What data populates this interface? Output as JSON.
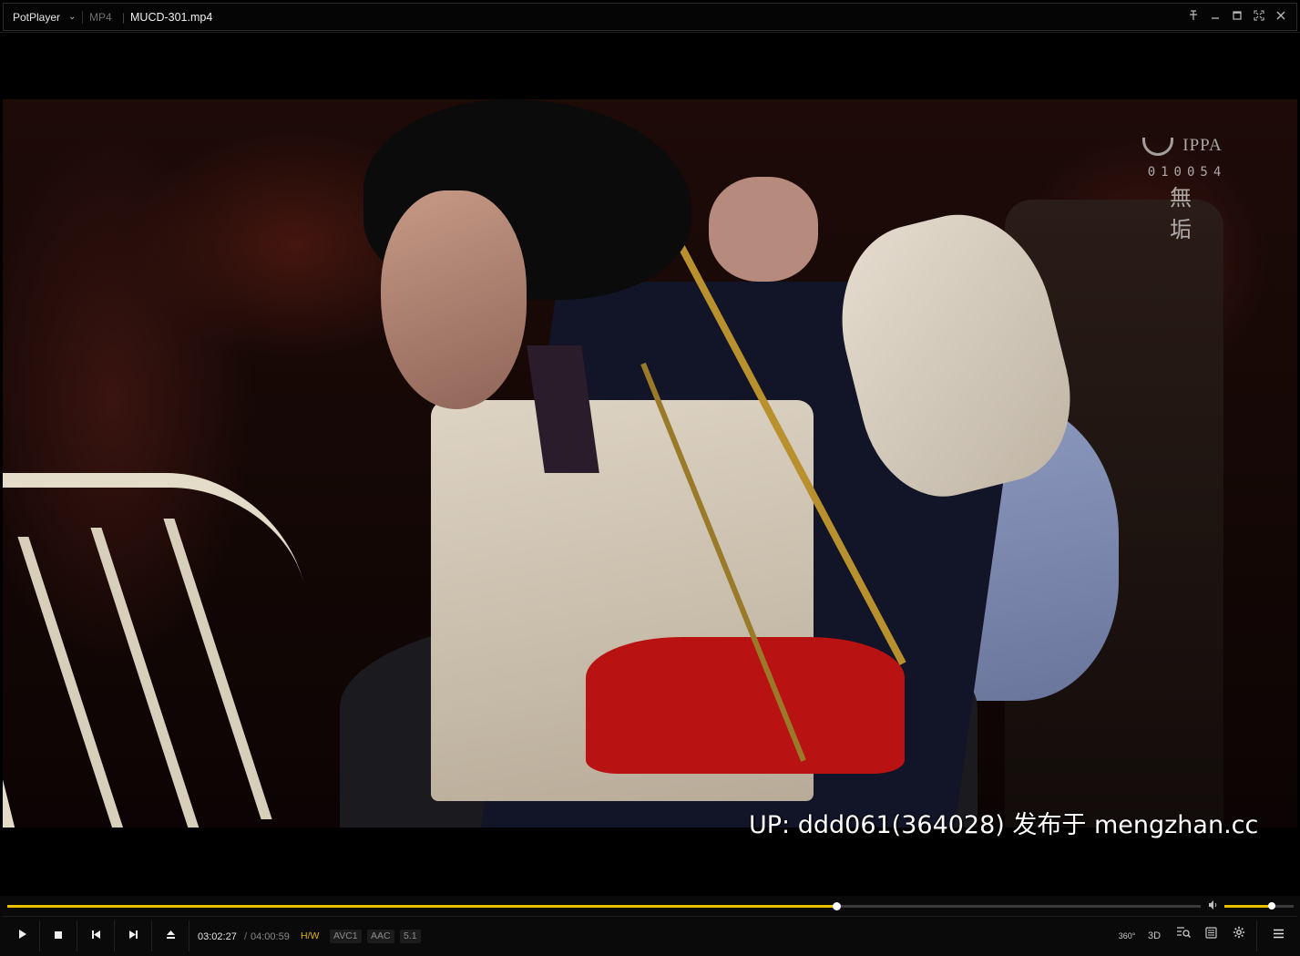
{
  "titlebar": {
    "app_name": "PotPlayer",
    "format": "MP4",
    "separator": "|",
    "file_name": "MUCD-301.mp4",
    "buttons": [
      "pin-icon",
      "minimize-icon",
      "maximize-icon",
      "fullscreen-icon",
      "close-icon"
    ]
  },
  "video": {
    "watermark": {
      "logo_text": "IPPA",
      "number": "010054",
      "kanji": "無 垢"
    },
    "subtitle": "UP: ddd061(364028) 发布于 mengzhan.cc"
  },
  "controls": {
    "seek_progress": 0.695,
    "volume_level": 0.68,
    "time_current": "03:02:27",
    "time_separator": "/",
    "time_total": "04:00:59",
    "badges": {
      "hw": "H/W",
      "video_codec": "AVC1",
      "audio_codec": "AAC",
      "channels": "5.1"
    },
    "right_icons": {
      "vr": "360°",
      "three_d": "3D"
    },
    "colors": {
      "accent": "#e8c000"
    }
  }
}
